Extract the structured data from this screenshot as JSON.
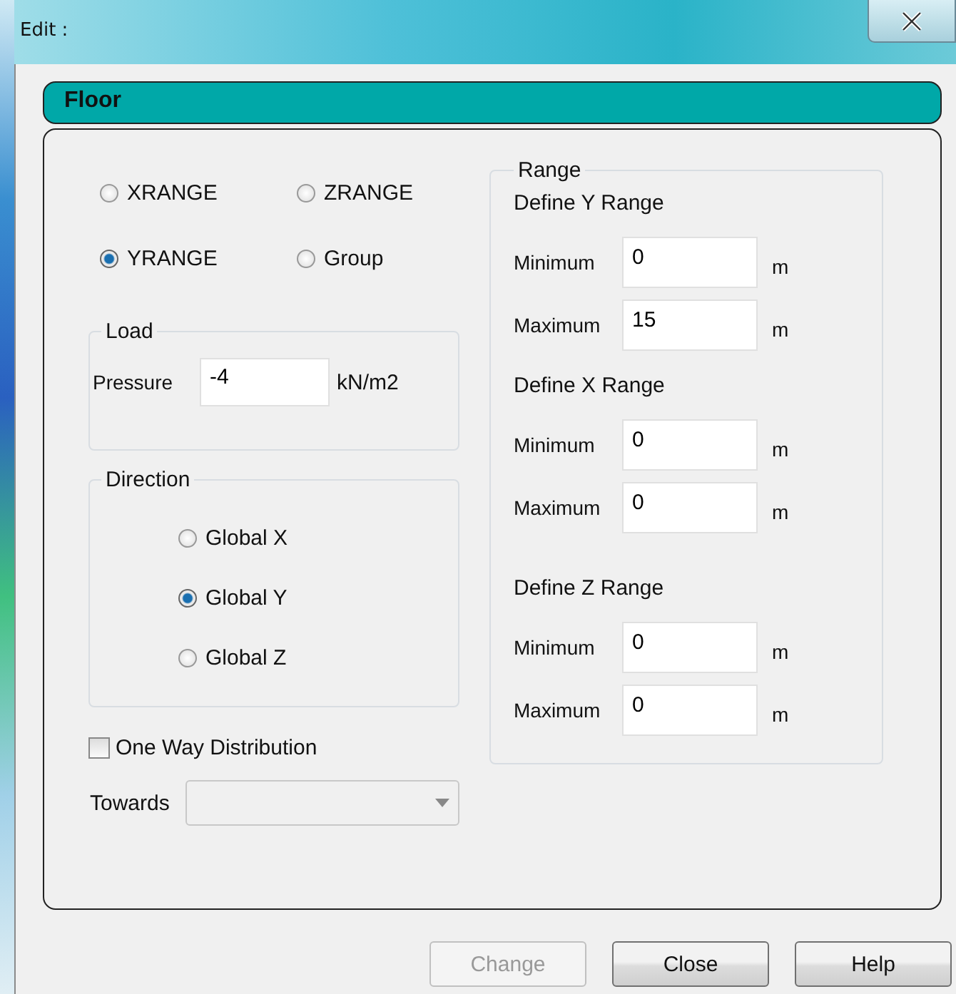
{
  "window": {
    "title": "Edit :"
  },
  "panel": {
    "title": "Floor"
  },
  "range_type": [
    {
      "label": "XRANGE",
      "selected": false
    },
    {
      "label": "ZRANGE",
      "selected": false
    },
    {
      "label": "YRANGE",
      "selected": true
    },
    {
      "label": "Group",
      "selected": false
    }
  ],
  "load": {
    "title": "Load",
    "label": "Pressure",
    "value": "-4",
    "unit": "kN/m2"
  },
  "direction": {
    "title": "Direction",
    "options": [
      {
        "label": "Global X",
        "selected": false
      },
      {
        "label": "Global Y",
        "selected": true
      },
      {
        "label": "Global Z",
        "selected": false
      }
    ]
  },
  "one_way_distribution": {
    "label": "One Way Distribution",
    "checked": false
  },
  "towards": {
    "label": "Towards",
    "disabled": true
  },
  "range": {
    "title": "Range",
    "sections": [
      {
        "title": "Define Y Range",
        "fields": [
          {
            "label": "Minimum",
            "value": "0",
            "unit": "m"
          },
          {
            "label": "Maximum",
            "value": "15",
            "unit": "m"
          }
        ]
      },
      {
        "title": "Define X Range",
        "fields": [
          {
            "label": "Minimum",
            "value": "0",
            "unit": "m"
          },
          {
            "label": "Maximum",
            "value": "0",
            "unit": "m"
          }
        ]
      },
      {
        "title": "Define Z Range",
        "fields": [
          {
            "label": "Minimum",
            "value": "0",
            "unit": "m"
          },
          {
            "label": "Maximum",
            "value": "0",
            "unit": "m"
          }
        ]
      }
    ]
  },
  "buttons": [
    {
      "label": "Change",
      "disabled": true
    },
    {
      "label": "Close",
      "disabled": false
    },
    {
      "label": "Help",
      "disabled": false
    }
  ]
}
